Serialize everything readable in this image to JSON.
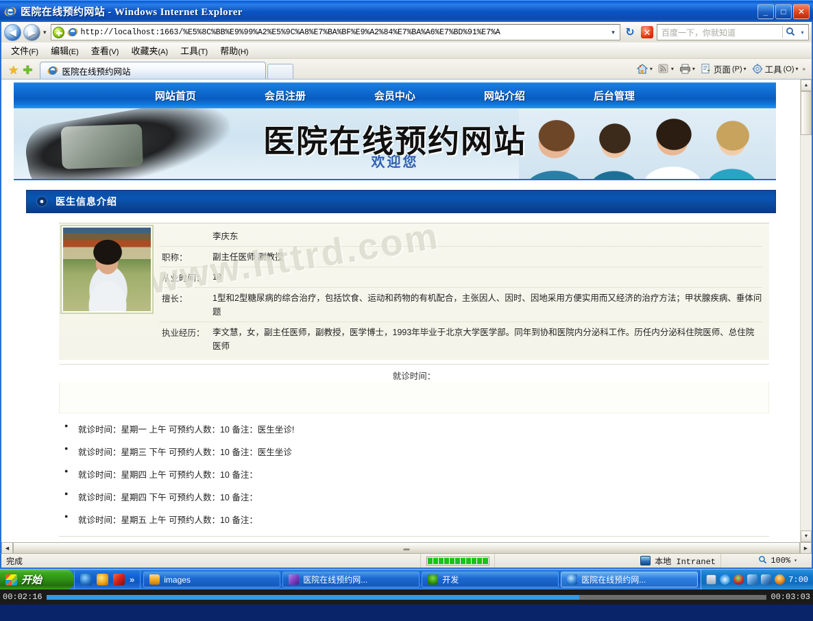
{
  "window": {
    "title": "医院在线预约网站 - Windows Internet Explorer",
    "minimize": "_",
    "maximize": "□",
    "close": "✕"
  },
  "browser": {
    "back_glyph": "◀",
    "forward_glyph": "▶",
    "history_caret": "▾",
    "url": "http://localhost:1663/%E5%8C%BB%E9%99%A2%E5%9C%A8%E7%BA%BF%E9%A2%84%E7%BA%A6%E7%BD%91%E7%A",
    "addr_caret": "▾",
    "refresh_glyph": "↻",
    "stop_glyph": "✕",
    "search_placeholder": "百度一下，你就知道",
    "search_glyph": "🔍",
    "search_caret": "▾",
    "menus": [
      {
        "label": "文件",
        "mnemonic": "(F)"
      },
      {
        "label": "编辑",
        "mnemonic": "(E)"
      },
      {
        "label": "查看",
        "mnemonic": "(V)"
      },
      {
        "label": "收藏夹",
        "mnemonic": "(A)"
      },
      {
        "label": "工具",
        "mnemonic": "(T)"
      },
      {
        "label": "帮助",
        "mnemonic": "(H)"
      }
    ],
    "tab_title": "医院在线预约网站",
    "toolbar": {
      "home_caret": "▾",
      "feeds_caret": "▾",
      "print_caret": "▾",
      "page_label": "页面",
      "page_mnemonic": "(P)",
      "page_caret": "▾",
      "tools_label": "工具",
      "tools_mnemonic": "(O)",
      "tools_caret": "▾",
      "overflow": "»"
    }
  },
  "site": {
    "nav": [
      "网站首页",
      "会员注册",
      "会员中心",
      "网站介绍",
      "后台管理"
    ],
    "banner_title": "医院在线预约网站",
    "banner_subtitle": "欢迎您",
    "section_title": "医生信息介绍",
    "watermark": "www.httrd.com"
  },
  "doctor": {
    "name": "李庆东",
    "fields": [
      {
        "label": "职称：",
        "value": "副主任医师 副教授"
      },
      {
        "label": "从业时间：",
        "value": "18"
      },
      {
        "label": "擅长：",
        "value": "1型和2型糖尿病的综合治疗，包括饮食、运动和药物的有机配合，主张因人、因时、因地采用方便实用而又经济的治疗方法；甲状腺疾病、垂体问题"
      },
      {
        "label": "执业经历：",
        "value": "李文慧，女，副主任医师，副教授，医学博士，1993年毕业于北京大学医学部。同年到协和医院内分泌科工作。历任内分泌科住院医师、总住院医师"
      }
    ],
    "visit_heading": "就诊时间：",
    "visits": [
      "就诊时间：星期一 上午 可预约人数：10 备注：医生坐诊!",
      "就诊时间：星期三 下午 可预约人数：10 备注：医生坐诊",
      "就诊时间：星期四 上午 可预约人数：10 备注：",
      "就诊时间：星期四 下午 可预约人数：10 备注：",
      "就诊时间：星期五 上午 可预约人数：10 备注："
    ]
  },
  "scrollbars": {
    "up": "▲",
    "down": "▼",
    "left": "◀",
    "right": "▶"
  },
  "statusbar": {
    "text": "完成",
    "zone": "本地 Intranet",
    "zoom": "100%",
    "zoom_caret": "▾"
  },
  "taskbar": {
    "start": "开始",
    "quicklaunch_overflow": "»",
    "items": [
      {
        "label": "images"
      },
      {
        "label": "医院在线预约网..."
      },
      {
        "label": "开发"
      },
      {
        "label": "医院在线预约网..."
      }
    ],
    "clock": "7:00"
  },
  "recorder": {
    "elapsed": "00:02:16",
    "total": "00:03:03"
  }
}
